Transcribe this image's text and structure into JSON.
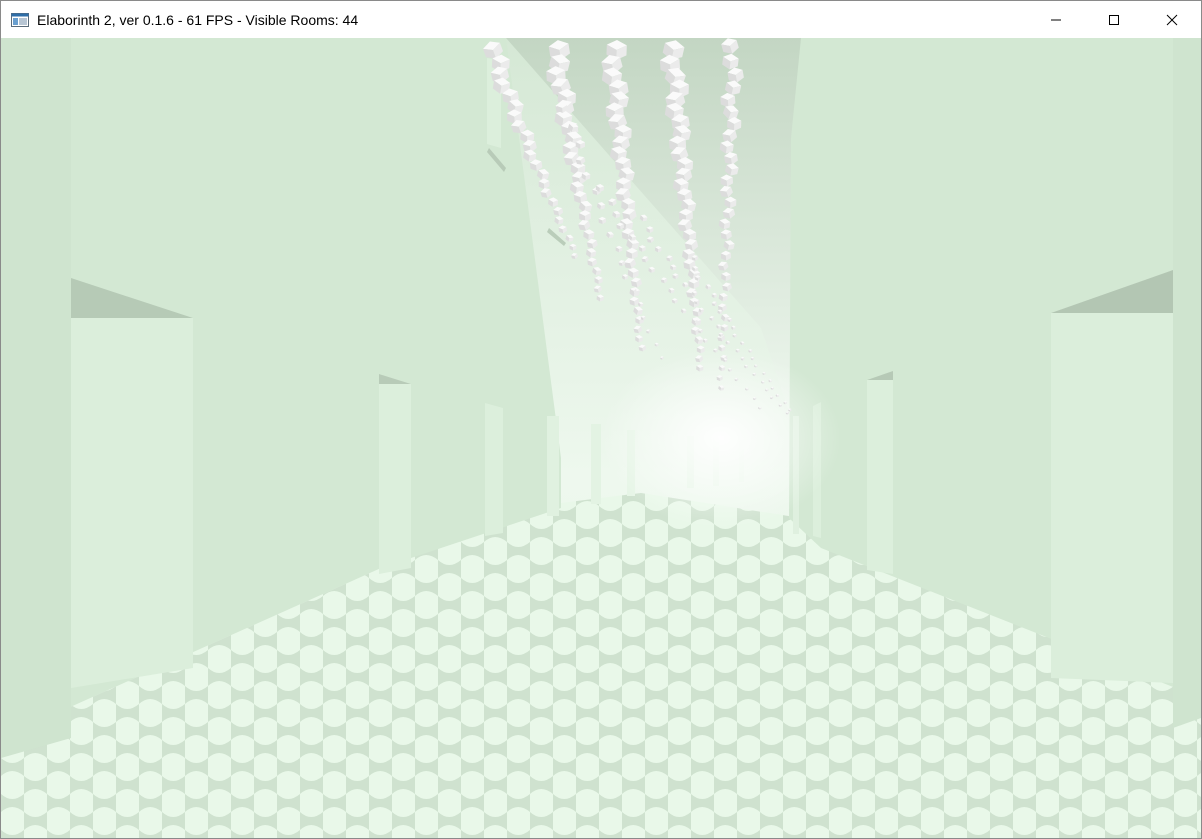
{
  "window": {
    "title": "Elaborinth 2, ver 0.1.6 - 61 FPS - Visible Rooms: 44",
    "icon": "app-window-icon",
    "controls": {
      "minimize_icon": "minimize-icon",
      "maximize_icon": "maximize-icon",
      "close_icon": "close-icon"
    }
  },
  "scene": {
    "description_icons": [
      "ceiling-cube-cluster",
      "corridor-wall",
      "checkered-floor",
      "doorway"
    ],
    "colors": {
      "fog": "#e8f4e8",
      "wall": "#d4e9d4",
      "wall_shadow": "#b5c8b5",
      "floor_light": "#e6f8e6",
      "floor_dark": "#c8ddc8",
      "ceiling": "#c5d8c5",
      "cube": "#f2f2f2"
    }
  }
}
